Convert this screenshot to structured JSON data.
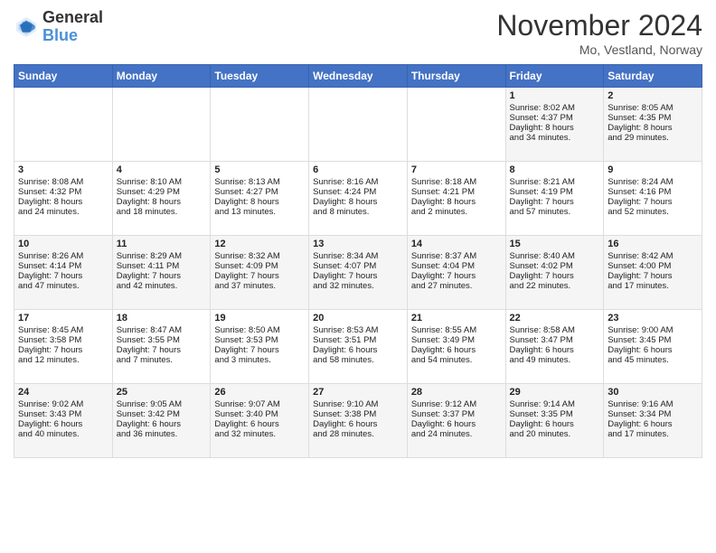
{
  "header": {
    "logo_line1": "General",
    "logo_line2": "Blue",
    "month": "November 2024",
    "location": "Mo, Vestland, Norway"
  },
  "weekdays": [
    "Sunday",
    "Monday",
    "Tuesday",
    "Wednesday",
    "Thursday",
    "Friday",
    "Saturday"
  ],
  "weeks": [
    [
      {
        "day": "",
        "content": ""
      },
      {
        "day": "",
        "content": ""
      },
      {
        "day": "",
        "content": ""
      },
      {
        "day": "",
        "content": ""
      },
      {
        "day": "",
        "content": ""
      },
      {
        "day": "1",
        "content": "Sunrise: 8:02 AM\nSunset: 4:37 PM\nDaylight: 8 hours\nand 34 minutes."
      },
      {
        "day": "2",
        "content": "Sunrise: 8:05 AM\nSunset: 4:35 PM\nDaylight: 8 hours\nand 29 minutes."
      }
    ],
    [
      {
        "day": "3",
        "content": "Sunrise: 8:08 AM\nSunset: 4:32 PM\nDaylight: 8 hours\nand 24 minutes."
      },
      {
        "day": "4",
        "content": "Sunrise: 8:10 AM\nSunset: 4:29 PM\nDaylight: 8 hours\nand 18 minutes."
      },
      {
        "day": "5",
        "content": "Sunrise: 8:13 AM\nSunset: 4:27 PM\nDaylight: 8 hours\nand 13 minutes."
      },
      {
        "day": "6",
        "content": "Sunrise: 8:16 AM\nSunset: 4:24 PM\nDaylight: 8 hours\nand 8 minutes."
      },
      {
        "day": "7",
        "content": "Sunrise: 8:18 AM\nSunset: 4:21 PM\nDaylight: 8 hours\nand 2 minutes."
      },
      {
        "day": "8",
        "content": "Sunrise: 8:21 AM\nSunset: 4:19 PM\nDaylight: 7 hours\nand 57 minutes."
      },
      {
        "day": "9",
        "content": "Sunrise: 8:24 AM\nSunset: 4:16 PM\nDaylight: 7 hours\nand 52 minutes."
      }
    ],
    [
      {
        "day": "10",
        "content": "Sunrise: 8:26 AM\nSunset: 4:14 PM\nDaylight: 7 hours\nand 47 minutes."
      },
      {
        "day": "11",
        "content": "Sunrise: 8:29 AM\nSunset: 4:11 PM\nDaylight: 7 hours\nand 42 minutes."
      },
      {
        "day": "12",
        "content": "Sunrise: 8:32 AM\nSunset: 4:09 PM\nDaylight: 7 hours\nand 37 minutes."
      },
      {
        "day": "13",
        "content": "Sunrise: 8:34 AM\nSunset: 4:07 PM\nDaylight: 7 hours\nand 32 minutes."
      },
      {
        "day": "14",
        "content": "Sunrise: 8:37 AM\nSunset: 4:04 PM\nDaylight: 7 hours\nand 27 minutes."
      },
      {
        "day": "15",
        "content": "Sunrise: 8:40 AM\nSunset: 4:02 PM\nDaylight: 7 hours\nand 22 minutes."
      },
      {
        "day": "16",
        "content": "Sunrise: 8:42 AM\nSunset: 4:00 PM\nDaylight: 7 hours\nand 17 minutes."
      }
    ],
    [
      {
        "day": "17",
        "content": "Sunrise: 8:45 AM\nSunset: 3:58 PM\nDaylight: 7 hours\nand 12 minutes."
      },
      {
        "day": "18",
        "content": "Sunrise: 8:47 AM\nSunset: 3:55 PM\nDaylight: 7 hours\nand 7 minutes."
      },
      {
        "day": "19",
        "content": "Sunrise: 8:50 AM\nSunset: 3:53 PM\nDaylight: 7 hours\nand 3 minutes."
      },
      {
        "day": "20",
        "content": "Sunrise: 8:53 AM\nSunset: 3:51 PM\nDaylight: 6 hours\nand 58 minutes."
      },
      {
        "day": "21",
        "content": "Sunrise: 8:55 AM\nSunset: 3:49 PM\nDaylight: 6 hours\nand 54 minutes."
      },
      {
        "day": "22",
        "content": "Sunrise: 8:58 AM\nSunset: 3:47 PM\nDaylight: 6 hours\nand 49 minutes."
      },
      {
        "day": "23",
        "content": "Sunrise: 9:00 AM\nSunset: 3:45 PM\nDaylight: 6 hours\nand 45 minutes."
      }
    ],
    [
      {
        "day": "24",
        "content": "Sunrise: 9:02 AM\nSunset: 3:43 PM\nDaylight: 6 hours\nand 40 minutes."
      },
      {
        "day": "25",
        "content": "Sunrise: 9:05 AM\nSunset: 3:42 PM\nDaylight: 6 hours\nand 36 minutes."
      },
      {
        "day": "26",
        "content": "Sunrise: 9:07 AM\nSunset: 3:40 PM\nDaylight: 6 hours\nand 32 minutes."
      },
      {
        "day": "27",
        "content": "Sunrise: 9:10 AM\nSunset: 3:38 PM\nDaylight: 6 hours\nand 28 minutes."
      },
      {
        "day": "28",
        "content": "Sunrise: 9:12 AM\nSunset: 3:37 PM\nDaylight: 6 hours\nand 24 minutes."
      },
      {
        "day": "29",
        "content": "Sunrise: 9:14 AM\nSunset: 3:35 PM\nDaylight: 6 hours\nand 20 minutes."
      },
      {
        "day": "30",
        "content": "Sunrise: 9:16 AM\nSunset: 3:34 PM\nDaylight: 6 hours\nand 17 minutes."
      }
    ]
  ]
}
